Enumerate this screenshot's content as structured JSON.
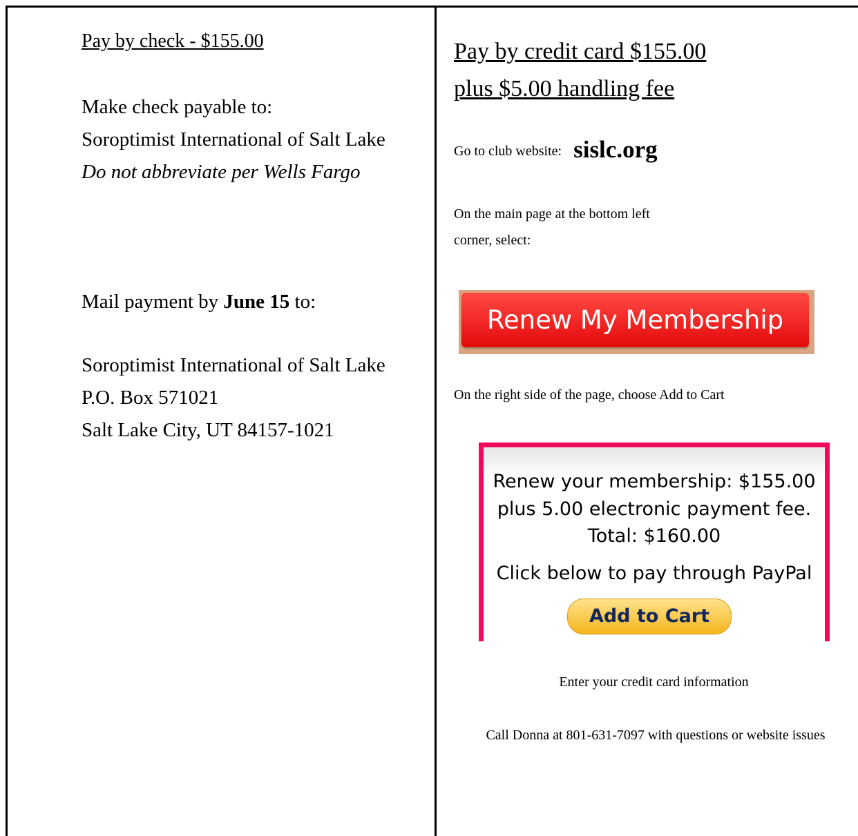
{
  "left": {
    "heading": "Pay by check - $155.00",
    "payable_label": "Make check payable to:",
    "payee": "Soroptimist International of Salt Lake",
    "note": "Do not abbreviate per Wells Fargo",
    "mail_prefix": "Mail payment by",
    "mail_date": "June 15",
    "mail_suffix": "to:",
    "address": [
      "Soroptimist International of Salt Lake",
      "P.O. Box 571021",
      "Salt Lake City, UT 84157-1021"
    ]
  },
  "right": {
    "heading_line1": "Pay by credit card $155.00",
    "heading_line2": "plus $5.00 handling fee",
    "website_label": "Go to club website:",
    "website": "sislc.org",
    "main_page_line1": "On the main page at the bottom left",
    "main_page_line2": "corner, select:",
    "renew_button": "Renew My Membership",
    "right_side_text": "On the right side of the page, choose Add to Cart",
    "paypal": {
      "line1": "Renew your membership: $155.00",
      "line2": "plus 5.00 electronic payment fee.",
      "line3": "Total: $160.00",
      "line4": "Click below to pay through PayPal",
      "button": "Add to Cart"
    },
    "enter_card": "Enter your credit card information",
    "contact": "Call Donna at 801-631-7097 with questions or website issues"
  }
}
